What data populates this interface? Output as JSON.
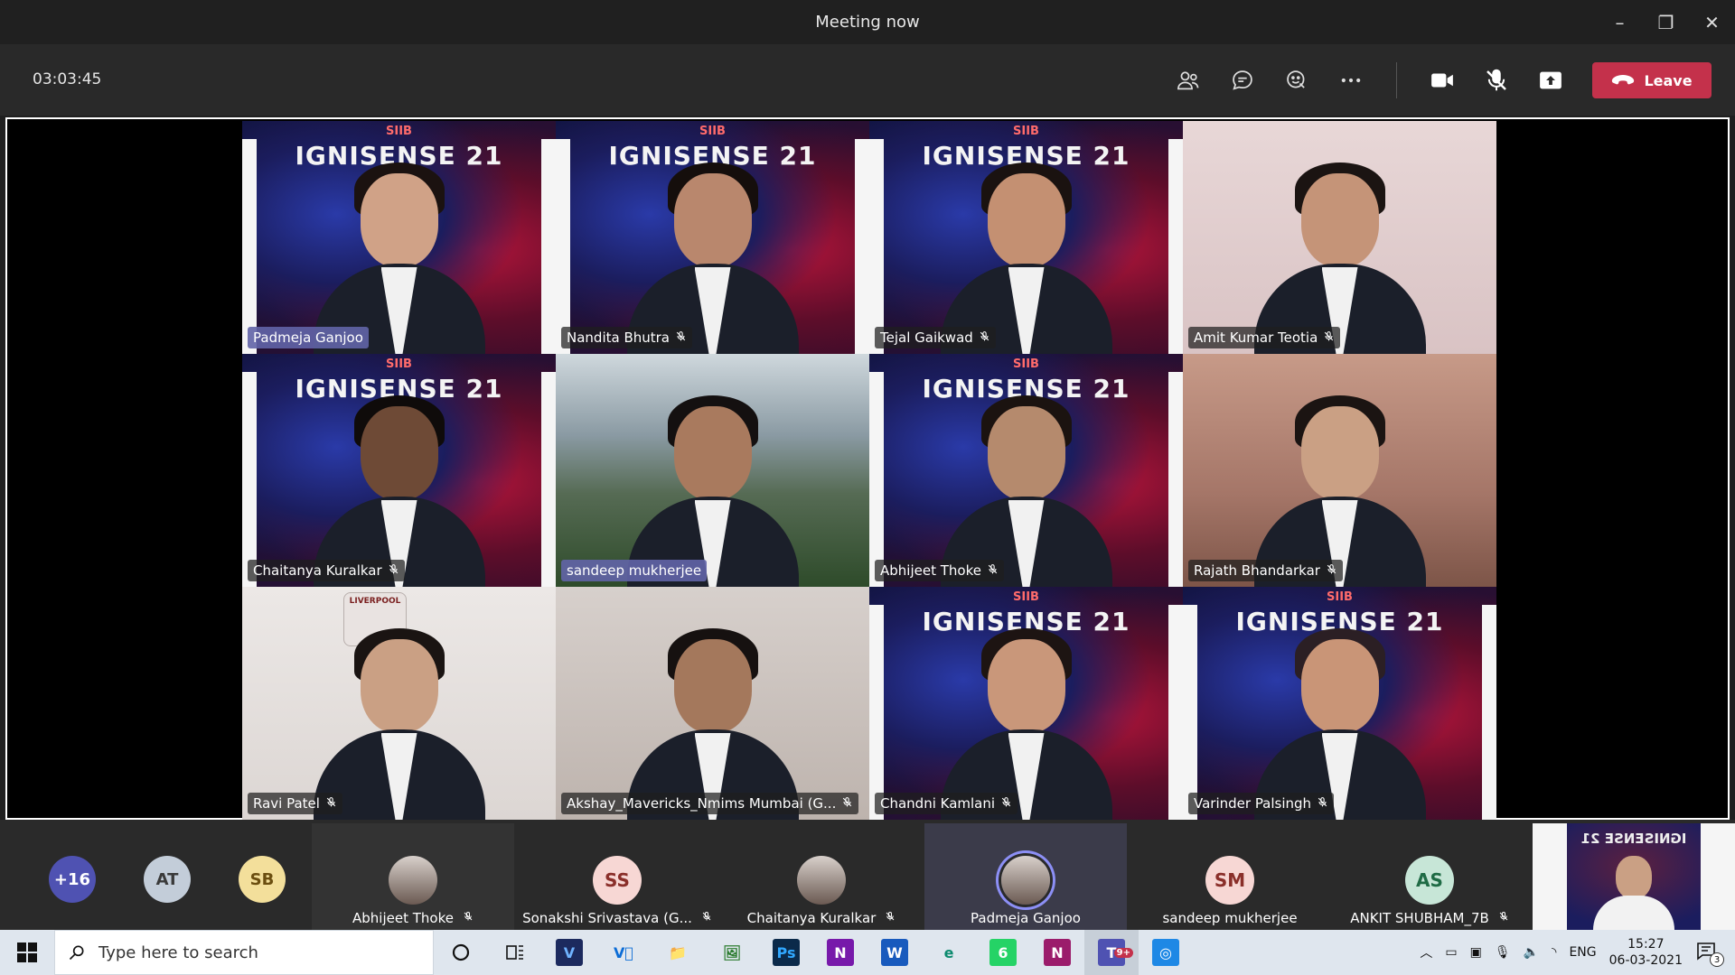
{
  "window": {
    "title": "Meeting now",
    "controls": [
      "–",
      "❐",
      "✕"
    ]
  },
  "toolbar": {
    "timer": "03:03:45",
    "leave_label": "Leave"
  },
  "tiles": [
    {
      "name": "Padmeja Ganjoo",
      "muted": false,
      "speaking": true,
      "bg": "bg-ignis",
      "brand": "SIIB",
      "banner": "IGNISENSE 21"
    },
    {
      "name": "Nandita Bhutra",
      "muted": true,
      "bg": "bg-ignis",
      "brand": "SIIB",
      "banner": "IGNISENSE 21"
    },
    {
      "name": "Tejal Gaikwad",
      "muted": true,
      "bg": "bg-ignis",
      "brand": "SIIB",
      "banner": "IGNISENSE 21"
    },
    {
      "name": "Amit Kumar Teotia",
      "muted": true,
      "bg": "bg-wall1",
      "brand": "",
      "banner": ""
    },
    {
      "name": "Chaitanya Kuralkar",
      "muted": true,
      "bg": "bg-ignis",
      "brand": "SIIB",
      "banner": "IGNISENSE 21"
    },
    {
      "name": "sandeep mukherjee",
      "muted": false,
      "speaking": true,
      "bg": "bg-mount",
      "brand": "",
      "banner": ""
    },
    {
      "name": "Abhijeet Thoke",
      "muted": true,
      "bg": "bg-ignis",
      "brand": "SIIB",
      "banner": "IGNISENSE 21"
    },
    {
      "name": "Rajath Bhandarkar",
      "muted": true,
      "bg": "bg-wall2",
      "brand": "",
      "banner": ""
    },
    {
      "name": "Ravi Patel",
      "muted": true,
      "bg": "bg-wall3",
      "brand": "",
      "banner": "",
      "logo": "LIVERPOOL"
    },
    {
      "name": "Akshay_Mavericks_Nmims Mumbai (G...",
      "muted": true,
      "bg": "bg-wall4",
      "brand": "",
      "banner": ""
    },
    {
      "name": "Chandni Kamlani",
      "muted": true,
      "bg": "bg-ignis",
      "brand": "SIIB",
      "banner": "IGNISENSE 21"
    },
    {
      "name": "Varinder Palsingh",
      "muted": true,
      "bg": "bg-ignis",
      "brand": "SIIB",
      "banner": "IGNISENSE 21"
    }
  ],
  "roster": {
    "overflow": {
      "label": "+16",
      "color": "#4f52b2"
    },
    "avatars": [
      {
        "initials": "AT",
        "bg": "#c3cdd9",
        "fg": "#3a3a3a"
      },
      {
        "initials": "SB",
        "bg": "#f3df9b",
        "fg": "#6b4e10"
      }
    ],
    "people": [
      {
        "name": "Abhijeet Thoke",
        "initials": "",
        "photo": true,
        "muted": true,
        "bg": "#333"
      },
      {
        "name": "Sonakshi Srivastava (G...",
        "initials": "SS",
        "avbg": "#f7d7d4",
        "avfg": "#8a2f2a",
        "muted": true,
        "bg": "#2a2a2a"
      },
      {
        "name": "Chaitanya Kuralkar",
        "initials": "",
        "photo": true,
        "muted": true,
        "bg": "#2a2a2a"
      },
      {
        "name": "Padmeja Ganjoo",
        "initials": "",
        "photo": true,
        "muted": false,
        "ring": true,
        "bg": "#3b3b4a"
      },
      {
        "name": "sandeep mukherjee",
        "initials": "SM",
        "avbg": "#f7d7d4",
        "avfg": "#8a2f2a",
        "muted": false,
        "bg": "#2a2a2a"
      },
      {
        "name": "ANKIT SHUBHAM_7B",
        "initials": "AS",
        "avbg": "#c7e6d7",
        "avfg": "#1f6b45",
        "muted": true,
        "bg": "#2a2a2a"
      }
    ],
    "self_view_text": "IGNISENSE 21"
  },
  "taskbar": {
    "search_placeholder": "Type here to search",
    "apps": [
      {
        "label": "V",
        "color": "#1c2a5e",
        "fg": "#6fb3ff"
      },
      {
        "label": "V⃝",
        "color": "#dfe6ee",
        "fg": "#0b6cd6"
      },
      {
        "label": "📁",
        "color": "#dfe6ee",
        "fg": "#e7b016"
      },
      {
        "label": "🖼",
        "color": "#dfe6ee",
        "fg": "#2e7d32"
      },
      {
        "label": "Ps",
        "color": "#0b2a4a",
        "fg": "#31a8ff"
      },
      {
        "label": "N",
        "color": "#7719aa",
        "fg": "#ffffff"
      },
      {
        "label": "W",
        "color": "#185abd",
        "fg": "#ffffff"
      },
      {
        "label": "e",
        "color": "#dfe6ee",
        "fg": "#0c8a6e"
      },
      {
        "label": "6",
        "color": "#25d366",
        "fg": "#ffffff"
      },
      {
        "label": "N",
        "color": "#9b1c6b",
        "fg": "#ffffff"
      },
      {
        "label": "T",
        "color": "#4f52b2",
        "fg": "#ffffff",
        "badge": "9+"
      },
      {
        "label": "◎",
        "color": "#1e88e5",
        "fg": "#ffffff"
      }
    ],
    "lang": "ENG",
    "time": "15:27",
    "date": "06-03-2021",
    "notifications": "3"
  }
}
